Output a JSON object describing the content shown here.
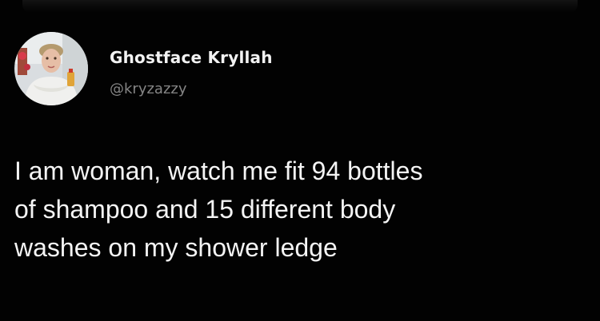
{
  "tweet": {
    "author": {
      "display_name": "Ghostface Kryllah",
      "handle": "@kryzazzy",
      "avatar_icon": "profile-photo"
    },
    "text": "I am woman, watch me fit 94 bottles\nof shampoo and 15 different body\nwashes on my shower ledge"
  },
  "colors": {
    "background": "#020202",
    "text_primary": "#f4f4f4",
    "text_secondary": "#858585"
  }
}
